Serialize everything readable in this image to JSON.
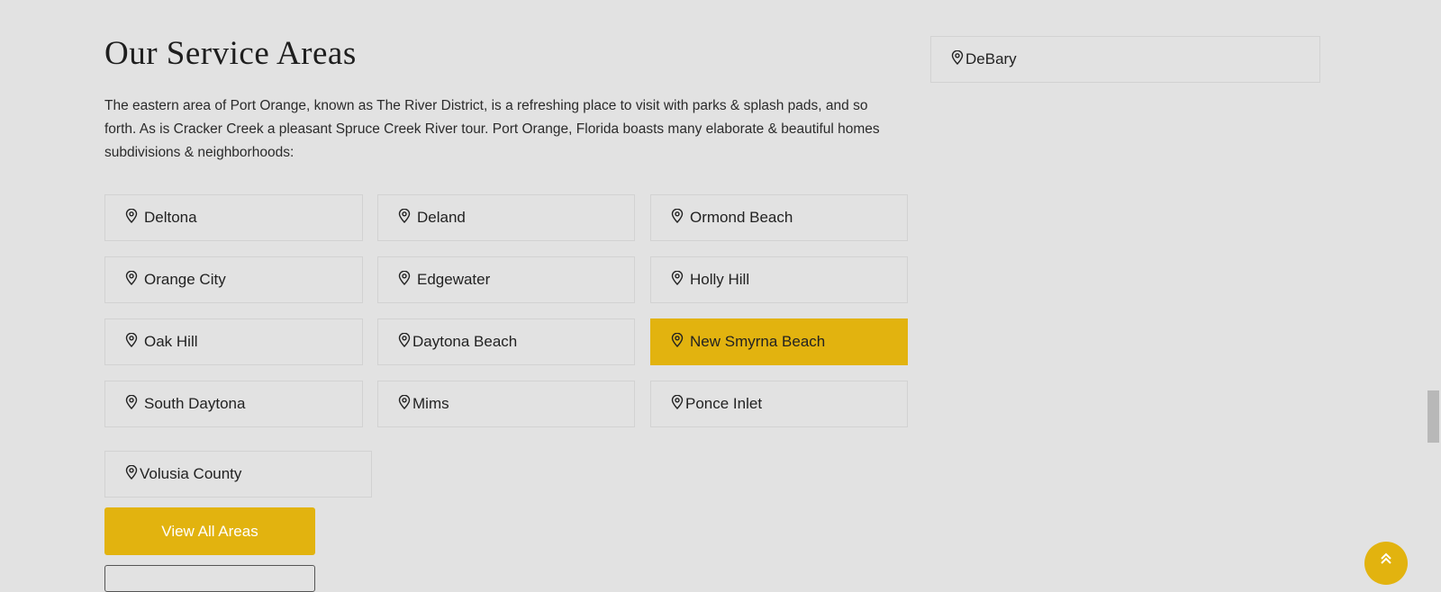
{
  "section": {
    "title": "Our Service Areas",
    "intro": "The eastern area of Port Orange, known as The River District, is a refreshing place to visit with parks & splash pads, and so forth. As is Cracker Creek a pleasant Spruce Creek River tour. Port Orange, Florida boasts many elaborate & beautiful homes subdivisions & neighborhoods:"
  },
  "icons": {
    "area": "location-pin-icon",
    "scroll_top": "double-chevron-up-icon"
  },
  "areas": [
    {
      "label": "Deltona"
    },
    {
      "label": "Deland"
    },
    {
      "label": "Ormond Beach"
    },
    {
      "label": "Orange City"
    },
    {
      "label": "Edgewater"
    },
    {
      "label": "Holly Hill"
    },
    {
      "label": "Oak Hill"
    },
    {
      "label": "Daytona Beach"
    },
    {
      "label": "New Smyrna Beach",
      "active": true
    },
    {
      "label": "South Daytona"
    },
    {
      "label": "Mims"
    },
    {
      "label": "Ponce Inlet"
    },
    {
      "label": "Volusia County"
    },
    {
      "label": "DeBary"
    }
  ],
  "cta": {
    "label": "View All Areas"
  },
  "colors": {
    "accent": "#e2b30f",
    "background": "#e2e2e2",
    "tile_border": "#d2d2d2"
  }
}
